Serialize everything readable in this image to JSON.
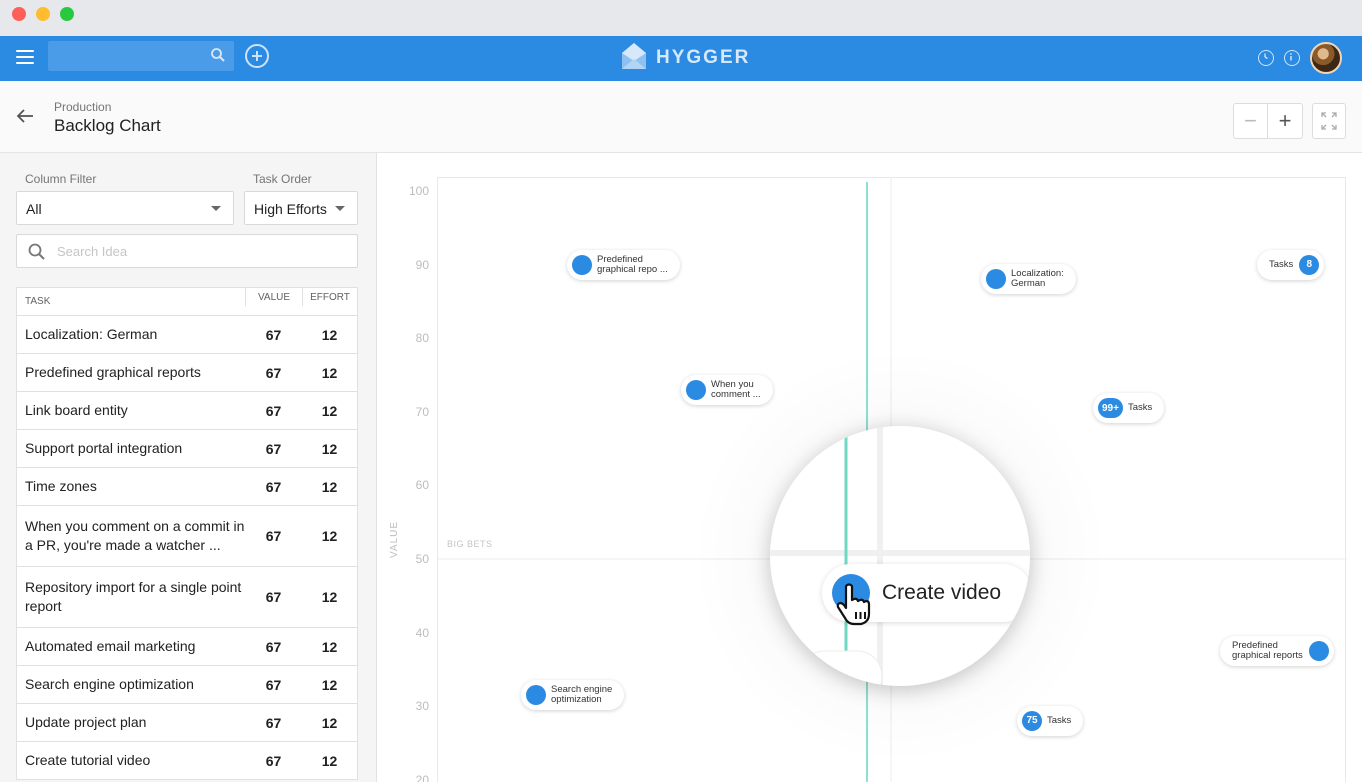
{
  "app": {
    "brand": "HYGGER"
  },
  "topbar": {
    "search_placeholder": ""
  },
  "header": {
    "breadcrumb": "Production",
    "title": "Backlog Chart",
    "zoom_out": "−",
    "zoom_in": "+"
  },
  "filters": {
    "column_filter_label": "Column Filter",
    "column_filter_value": "All",
    "task_order_label": "Task Order",
    "task_order_value": "High Efforts",
    "search_placeholder": "Search Idea"
  },
  "table": {
    "headers": {
      "task": "TASK",
      "value": "VALUE",
      "effort": "EFFORT"
    },
    "rows": [
      {
        "task": "Localization: German",
        "value": "67",
        "effort": "12"
      },
      {
        "task": "Predefined graphical reports",
        "value": "67",
        "effort": "12"
      },
      {
        "task": "Link board entity",
        "value": "67",
        "effort": "12"
      },
      {
        "task": "Support portal integration",
        "value": "67",
        "effort": "12"
      },
      {
        "task": "Time zones",
        "value": "67",
        "effort": "12"
      },
      {
        "task": "When you comment on a commit in a PR, you're made a watcher ...",
        "value": "67",
        "effort": "12"
      },
      {
        "task": "Repository import for a single point report",
        "value": "67",
        "effort": "12"
      },
      {
        "task": "Automated email marketing",
        "value": "67",
        "effort": "12"
      },
      {
        "task": "Search engine optimization",
        "value": "67",
        "effort": "12"
      },
      {
        "task": "Update project plan",
        "value": "67",
        "effort": "12"
      },
      {
        "task": "Create tutorial video",
        "value": "67",
        "effort": "12"
      }
    ]
  },
  "chart": {
    "y_axis_label": "VALUE",
    "y_ticks": [
      "100",
      "90",
      "80",
      "70",
      "60",
      "50",
      "40",
      "30",
      "20"
    ],
    "quadrant_label": "BIG BETS",
    "bubbles": [
      {
        "text": "Predefined\ngraphical repo ...",
        "value": 90
      },
      {
        "text": "Localization:\nGerman",
        "value": 88
      },
      {
        "text": "When you\ncomment ...",
        "value": 73
      },
      {
        "text": "Search engine\noptimization",
        "value": 31.5
      },
      {
        "text": "Predefined\ngraphical reports",
        "value": 37.5
      }
    ],
    "groups": [
      {
        "label": "Tasks",
        "count": "8",
        "value": 90
      },
      {
        "label": "Tasks",
        "count": "99+",
        "value": 70.5
      },
      {
        "label": "Tasks",
        "count": "75",
        "value": 28
      }
    ],
    "focused": {
      "text": "Create video"
    }
  }
}
